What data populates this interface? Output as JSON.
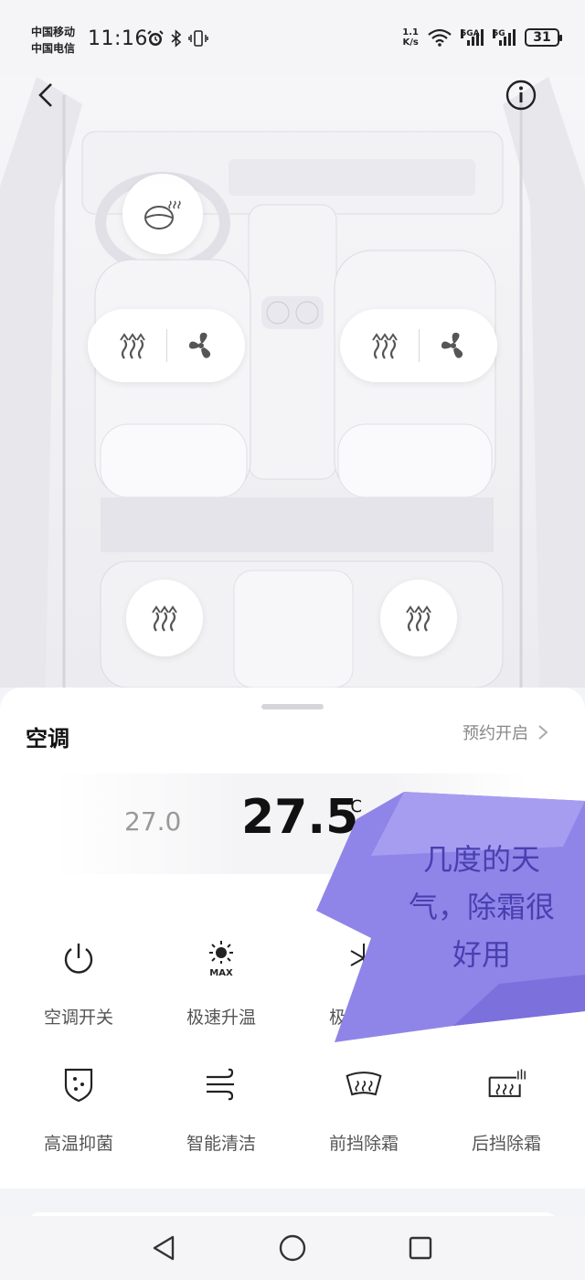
{
  "status_bar": {
    "carrier_1": "中国移动",
    "carrier_2": "中国电信",
    "time": "11:16",
    "net_speed_value": "1.1",
    "net_speed_unit": "K/s",
    "signal_1_label": "5GA",
    "signal_2_label": "5G",
    "battery": "31"
  },
  "header": {
    "back_icon": "chevron-left-icon",
    "info_icon": "info-circle-icon"
  },
  "car_controls": {
    "steering_heat_icon": "steering-wheel-heat-icon",
    "front_left": {
      "heat_icon": "seat-heat-icon",
      "vent_icon": "seat-fan-icon"
    },
    "front_right": {
      "heat_icon": "seat-heat-icon",
      "vent_icon": "seat-fan-icon"
    },
    "rear_left_icon": "seat-heat-icon",
    "rear_right_icon": "seat-heat-icon"
  },
  "climate": {
    "title": "空调",
    "schedule_label": "预约开启",
    "temp_prev": "27.0",
    "temp_current": "27.5",
    "temp_unit": "℃"
  },
  "functions": [
    {
      "label": "空调开关",
      "icon": "power-icon"
    },
    {
      "label": "极速升温",
      "icon": "sun-max-icon"
    },
    {
      "label": "极速降温",
      "icon": "snowflake-icon"
    },
    {
      "label": "",
      "icon": ""
    },
    {
      "label": "高温抑菌",
      "icon": "shield-sterilize-icon"
    },
    {
      "label": "智能清洁",
      "icon": "wind-clean-icon"
    },
    {
      "label": "前挡除霜",
      "icon": "front-defrost-icon"
    },
    {
      "label": "后挡除霜",
      "icon": "rear-defrost-icon"
    }
  ],
  "overlay": {
    "text": "几度的天气，除霜很好用",
    "color": "#8f85e8"
  },
  "navbar": {
    "back_icon": "nav-back-icon",
    "home_icon": "nav-home-icon",
    "recents_icon": "nav-recents-icon"
  }
}
